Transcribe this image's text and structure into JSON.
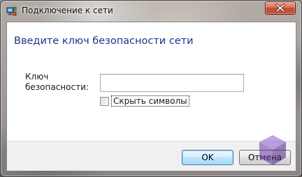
{
  "window": {
    "title": "Подключение к сети",
    "app_icon": "network-icon",
    "close_icon": "close-icon"
  },
  "dialog": {
    "heading": "Введите ключ безопасности сети",
    "key_label_line1": "Ключ",
    "key_label_line2": "безопасности:",
    "key_value": "",
    "hide_chars": {
      "label": "Скрыть символы",
      "checked": false
    }
  },
  "buttons": {
    "ok": "OK",
    "cancel": "Отмена"
  },
  "colors": {
    "heading": "#1e3287",
    "close_button": "#c8583a",
    "footer": "#f0f0f0",
    "watermark": "#5b2d91"
  },
  "watermark": {
    "icon": "cube-logo-icon"
  }
}
